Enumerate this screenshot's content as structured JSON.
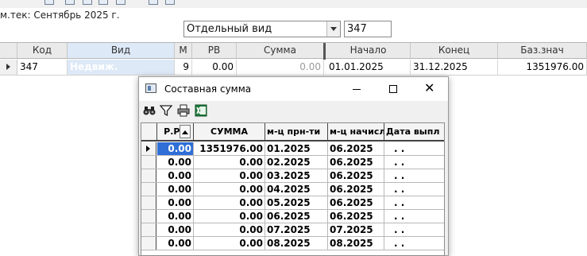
{
  "header": {
    "period_label": "м.тек: Сентябрь 2025 г."
  },
  "filters": {
    "view_value": "Отдельный вид",
    "number_value": "347"
  },
  "main_grid": {
    "columns": [
      "Код",
      "Вид",
      "М",
      "РВ",
      "Сумма",
      "Начало",
      "Конец",
      "Баз.знач"
    ],
    "row": {
      "kod": "347",
      "vid": "Недвиж.",
      "m": "9",
      "rv": "0.00",
      "summa": "0.00",
      "nachalo": "01.01.2025",
      "konec": "31.12.2025",
      "baz": "1351976.00"
    }
  },
  "modal": {
    "title": "Составная сумма",
    "toolbar_icons": [
      "binoculars-icon",
      "filter-icon",
      "printer-icon",
      "excel-icon"
    ],
    "columns": [
      "Р.РВ",
      "СУММА",
      "м-ц прн-ти",
      "м-ц начисл",
      "Дата выпл"
    ],
    "rows": [
      {
        "rrv": "0.00",
        "summa": "1351976.00",
        "prn": "01.2025",
        "nach": "06.2025",
        "data": ". ."
      },
      {
        "rrv": "0.00",
        "summa": "0.00",
        "prn": "02.2025",
        "nach": "06.2025",
        "data": ". ."
      },
      {
        "rrv": "0.00",
        "summa": "0.00",
        "prn": "03.2025",
        "nach": "06.2025",
        "data": ". ."
      },
      {
        "rrv": "0.00",
        "summa": "0.00",
        "prn": "04.2025",
        "nach": "06.2025",
        "data": ". ."
      },
      {
        "rrv": "0.00",
        "summa": "0.00",
        "prn": "05.2025",
        "nach": "06.2025",
        "data": ". ."
      },
      {
        "rrv": "0.00",
        "summa": "0.00",
        "prn": "06.2025",
        "nach": "06.2025",
        "data": ". ."
      },
      {
        "rrv": "0.00",
        "summa": "0.00",
        "prn": "07.2025",
        "nach": "07.2025",
        "data": ". ."
      },
      {
        "rrv": "0.00",
        "summa": "0.00",
        "prn": "08.2025",
        "nach": "08.2025",
        "data": ". ."
      }
    ]
  },
  "colors": {
    "selection": "#2f6fd6",
    "selected_text": "#ffffff",
    "row_highlight": "#dde9f7"
  }
}
